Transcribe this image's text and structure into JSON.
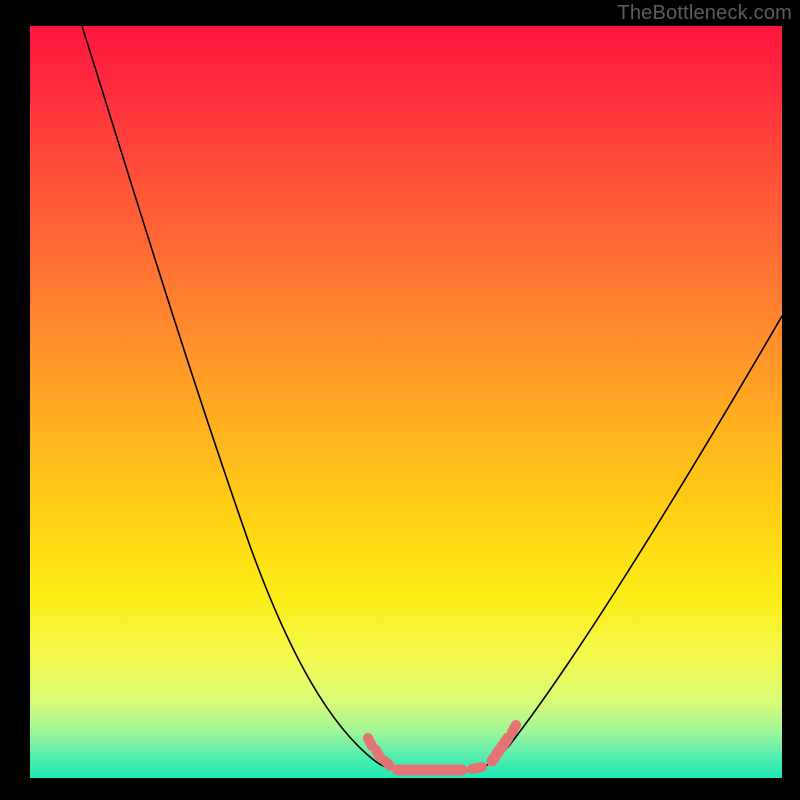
{
  "watermark": "TheBottleneck.com",
  "colors": {
    "dash": "#e57373",
    "curve": "#000000",
    "background": "#000000"
  },
  "chart_data": {
    "type": "line",
    "title": "",
    "xlabel": "",
    "ylabel": "",
    "xlim": [
      0,
      100
    ],
    "ylim": [
      0,
      100
    ],
    "note": "Axes are unlabeled; x and y values are estimated as percentages of plot width/height. y=0 is the bottom (green) and y=100 is the top (red). The curve is a V-shaped bottleneck profile with a flat minimum near zero.",
    "series": [
      {
        "name": "bottleneck-curve",
        "x": [
          7,
          12,
          18,
          24,
          30,
          36,
          42,
          46,
          48,
          50,
          54,
          58,
          62,
          68,
          76,
          84,
          92,
          100
        ],
        "y": [
          100,
          84,
          68,
          52,
          37,
          24,
          12,
          5,
          2,
          1,
          1,
          2,
          6,
          14,
          26,
          38,
          50,
          62
        ]
      }
    ],
    "highlight_segments": {
      "note": "Pink dashed/capsule segments marking the low region of the curve",
      "points_xy": [
        [
          45,
          6
        ],
        [
          46,
          4
        ],
        [
          48,
          2
        ],
        [
          50,
          1.2
        ],
        [
          54,
          1.2
        ],
        [
          58,
          1.4
        ],
        [
          61,
          3
        ],
        [
          62,
          5
        ],
        [
          63,
          7
        ]
      ]
    },
    "gradient_stops": [
      {
        "pos": 0,
        "color": "#ff163f"
      },
      {
        "pos": 30,
        "color": "#ff6d34"
      },
      {
        "pos": 66,
        "color": "#ffd313"
      },
      {
        "pos": 90,
        "color": "#d8fb78"
      },
      {
        "pos": 100,
        "color": "#1de9b6"
      }
    ]
  }
}
